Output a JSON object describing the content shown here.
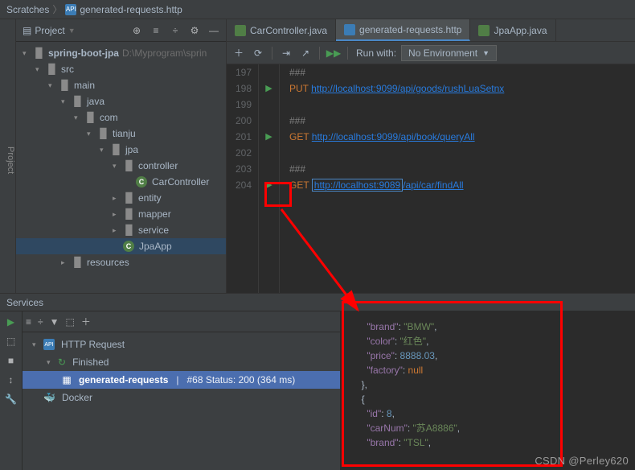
{
  "breadcrumb": {
    "root": "Scratches",
    "file": "generated-requests.http"
  },
  "project": {
    "title": "Project",
    "root": {
      "name": "spring-boot-jpa",
      "path": "D:\\Myprogram\\sprin"
    },
    "tree": [
      "src",
      "main",
      "java",
      "com",
      "tianju",
      "jpa",
      "controller",
      "CarController",
      "entity",
      "mapper",
      "service",
      "JpaApp",
      "resources"
    ]
  },
  "tabs": [
    {
      "label": "CarController.java",
      "icon": "#507e46"
    },
    {
      "label": "generated-requests.http",
      "icon": "#3b7cb5",
      "active": true
    },
    {
      "label": "JpaApp.java",
      "icon": "#507e46"
    }
  ],
  "toolbar": {
    "runwith": "Run with:",
    "env": "No Environment"
  },
  "code": {
    "lines": [
      {
        "n": 197,
        "t": "###",
        "run": false,
        "cls": "comment"
      },
      {
        "n": 198,
        "t": "PUT http://localhost:9099/api/goods/rushLuaSetnx",
        "run": true,
        "method": "PUT"
      },
      {
        "n": 199,
        "t": "",
        "run": false
      },
      {
        "n": 200,
        "t": "###",
        "run": false,
        "cls": "comment"
      },
      {
        "n": 201,
        "t": "GET http://localhost:9099/api/book/queryAll",
        "run": true,
        "method": "GET"
      },
      {
        "n": 202,
        "t": "",
        "run": false
      },
      {
        "n": 203,
        "t": "###",
        "run": false,
        "cls": "comment"
      },
      {
        "n": 204,
        "t": "GET http://localhost:9089/api/car/findAll",
        "run": true,
        "method": "GET",
        "boxed": true
      }
    ]
  },
  "services": {
    "title": "Services",
    "httpreq": "HTTP Request",
    "finished": "Finished",
    "reqname": "generated-requests",
    "reqmeta": "#68 Status: 200 (364 ms)",
    "docker": "Docker",
    "pipe": "|"
  },
  "json": [
    {
      "indent": 2,
      "k": "brand",
      "v": "BMW",
      "t": "s",
      "c": true
    },
    {
      "indent": 2,
      "k": "color",
      "v": "红色",
      "t": "s",
      "c": true
    },
    {
      "indent": 2,
      "k": "price",
      "v": "8888.03",
      "t": "n",
      "c": true
    },
    {
      "indent": 2,
      "k": "factory",
      "v": "null",
      "t": "null",
      "c": false
    },
    {
      "indent": 1,
      "brace": "},"
    },
    {
      "indent": 1,
      "brace": "{"
    },
    {
      "indent": 2,
      "k": "id",
      "v": "8",
      "t": "n",
      "c": true
    },
    {
      "indent": 2,
      "k": "carNum",
      "v": "苏A8886",
      "t": "s",
      "c": true
    },
    {
      "indent": 2,
      "k": "brand",
      "v": "TSL",
      "t": "s",
      "c": true
    }
  ],
  "watermark": "CSDN @Perley620"
}
